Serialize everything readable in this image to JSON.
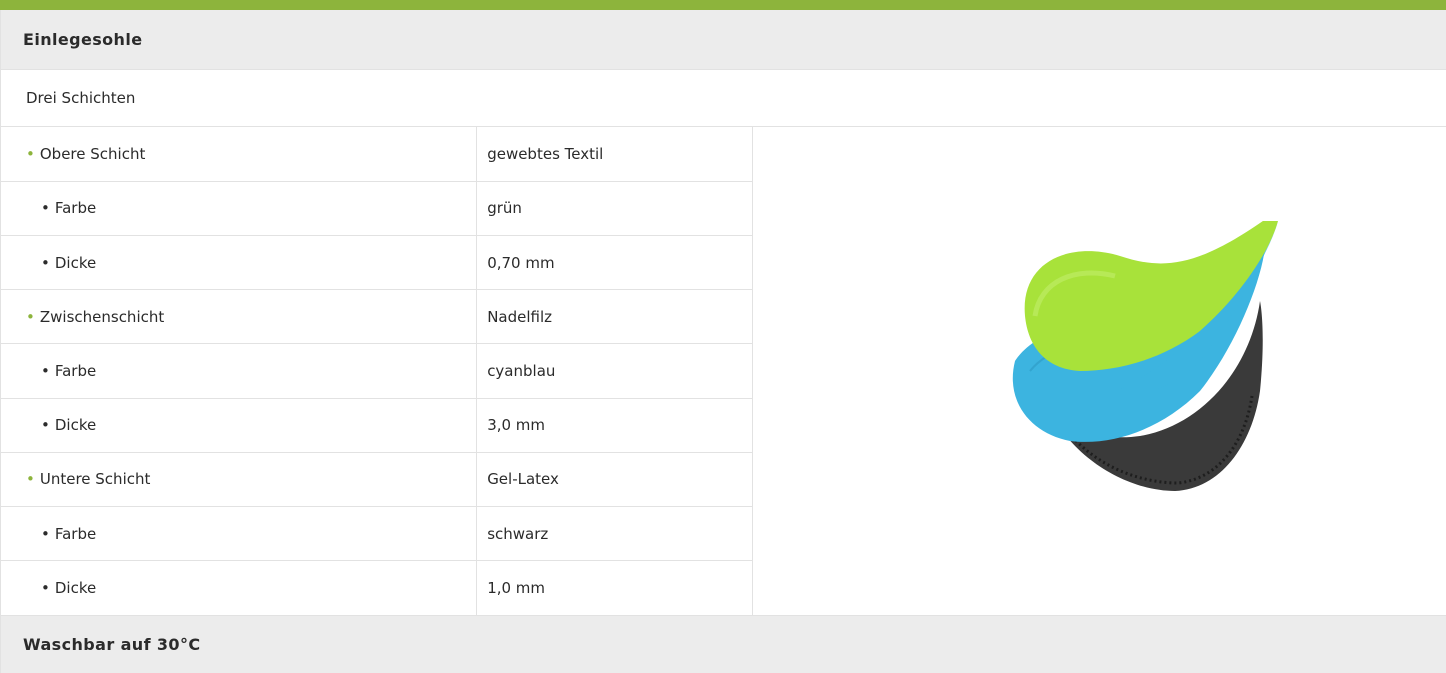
{
  "section_title": "Einlegesohle",
  "intro": "Drei Schichten",
  "rows": [
    {
      "label": "Obere Schicht",
      "value": "gewebtes Textil"
    },
    {
      "label": "Farbe",
      "value": "grün"
    },
    {
      "label": "Dicke",
      "value": "0,70 mm"
    },
    {
      "label": "Zwischenschicht",
      "value": "Nadelfilz"
    },
    {
      "label": "Farbe",
      "value": "cyanblau"
    },
    {
      "label": "Dicke",
      "value": "3,0 mm"
    },
    {
      "label": "Untere Schicht",
      "value": "Gel-Latex"
    },
    {
      "label": "Farbe",
      "value": "schwarz"
    },
    {
      "label": "Dicke",
      "value": "1,0 mm"
    }
  ],
  "bullet_glyph": "•",
  "footer_title": "Waschbar auf 30°C",
  "colors": {
    "accent": "#8db43c",
    "header_bg": "#ececec",
    "layer_top": "#a8e23a",
    "layer_middle": "#3cb4e0",
    "layer_bottom": "#3a3a3a"
  },
  "image": {
    "icon": "insole-layers-illustration"
  }
}
